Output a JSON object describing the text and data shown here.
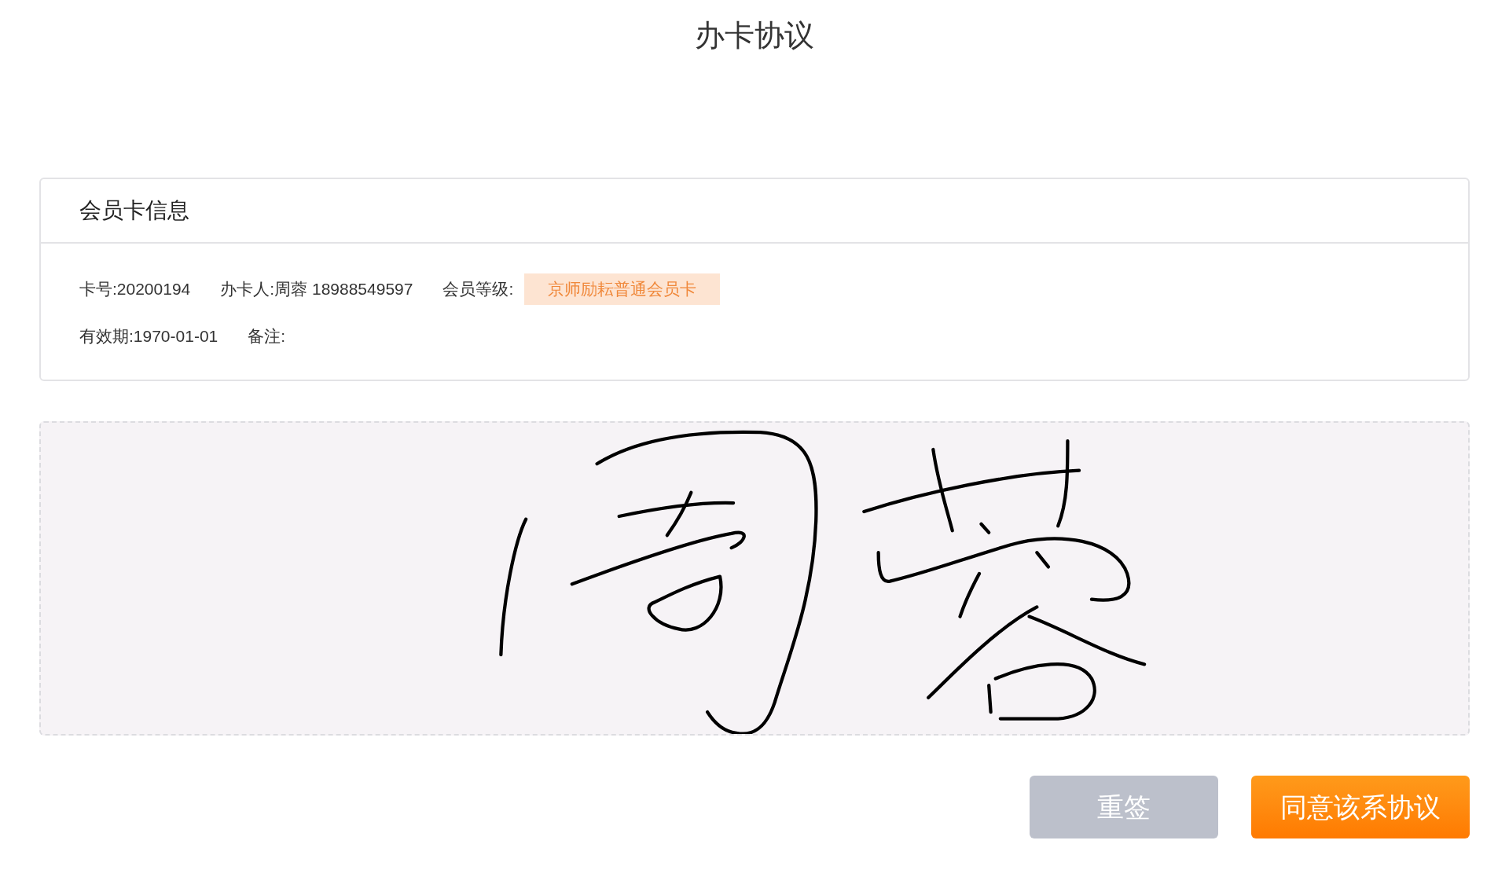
{
  "title": "办卡协议",
  "card": {
    "heading": "会员卡信息",
    "rows": [
      [
        {
          "kind": "text",
          "text": "卡号:20200194"
        },
        {
          "kind": "text",
          "text": "办卡人:周蓉 18988549597"
        },
        {
          "kind": "text",
          "text": "会员等级:"
        },
        {
          "kind": "badge",
          "text": "京师励耘普通会员卡"
        }
      ],
      [
        {
          "kind": "text",
          "text": "有效期:1970-01-01"
        },
        {
          "kind": "text",
          "text": "备注:"
        }
      ]
    ]
  },
  "signature_pad": {
    "signed": true
  },
  "buttons": [
    {
      "kind": "secondary",
      "label": "重签"
    },
    {
      "kind": "primary",
      "label": "同意该系协议"
    }
  ]
}
